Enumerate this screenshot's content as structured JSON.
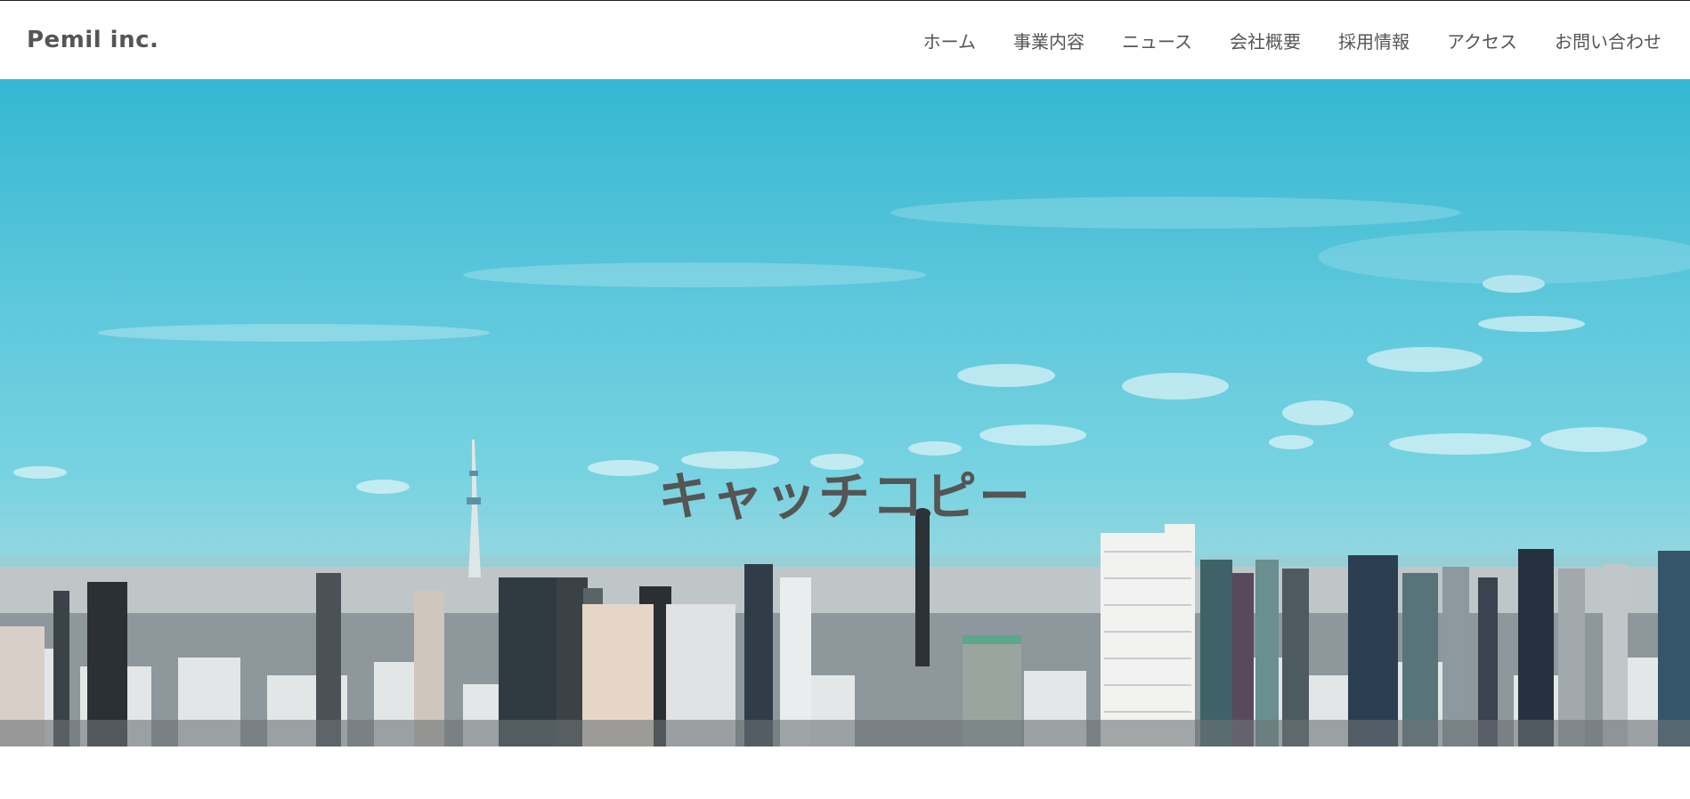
{
  "site": {
    "logo": "Pemil inc."
  },
  "nav": {
    "items": [
      {
        "label": "ホーム"
      },
      {
        "label": "事業内容"
      },
      {
        "label": "ニュース"
      },
      {
        "label": "会社概要"
      },
      {
        "label": "採用情報"
      },
      {
        "label": "アクセス"
      },
      {
        "label": "お問い合わせ"
      }
    ]
  },
  "hero": {
    "catchcopy": "キャッチコピー",
    "image": "city-skyline-photo"
  },
  "colors": {
    "text": "#555555",
    "sky": "#4cc1d8",
    "header_bg": "#ffffff"
  }
}
